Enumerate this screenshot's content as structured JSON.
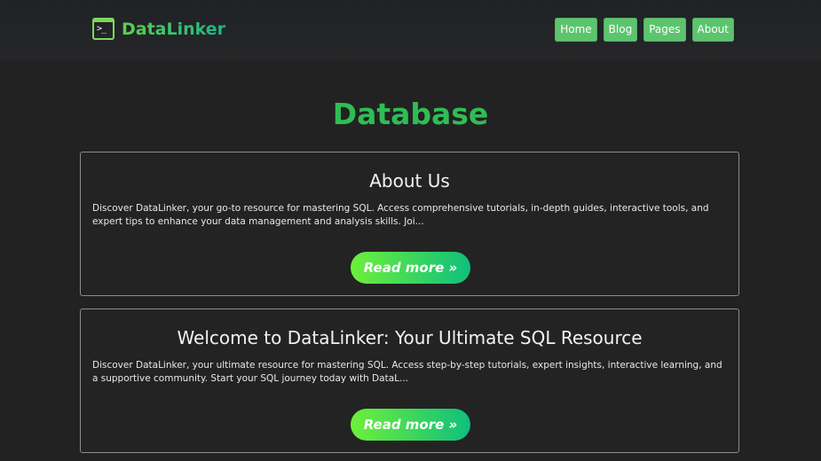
{
  "brand": {
    "name": "DataLinker",
    "icon": "terminal-icon",
    "icon_glyph": ">_"
  },
  "nav": {
    "items": [
      {
        "label": "Home"
      },
      {
        "label": "Blog"
      },
      {
        "label": "Pages"
      },
      {
        "label": "About"
      }
    ]
  },
  "page": {
    "title": "Database"
  },
  "posts": [
    {
      "title": "About Us",
      "excerpt": "Discover DataLinker, your go-to resource for mastering SQL. Access comprehensive tutorials, in-depth guides, interactive tools, and expert tips to enhance your data management and analysis skills. Joi...",
      "read_more": "Read more »"
    },
    {
      "title": "Welcome to DataLinker: Your Ultimate SQL Resource",
      "excerpt": "Discover DataLinker, your ultimate resource for mastering SQL. Access step-by-step tutorials, expert insights, interactive learning, and a supportive community. Start your SQL journey today with DataL...",
      "read_more": "Read more »"
    }
  ],
  "colors": {
    "background": "#222222",
    "accent_green": "#2fbd55",
    "nav_button": "#5cc46e",
    "button_gradient_start": "#6ef03a",
    "button_gradient_end": "#0fbf7c"
  }
}
